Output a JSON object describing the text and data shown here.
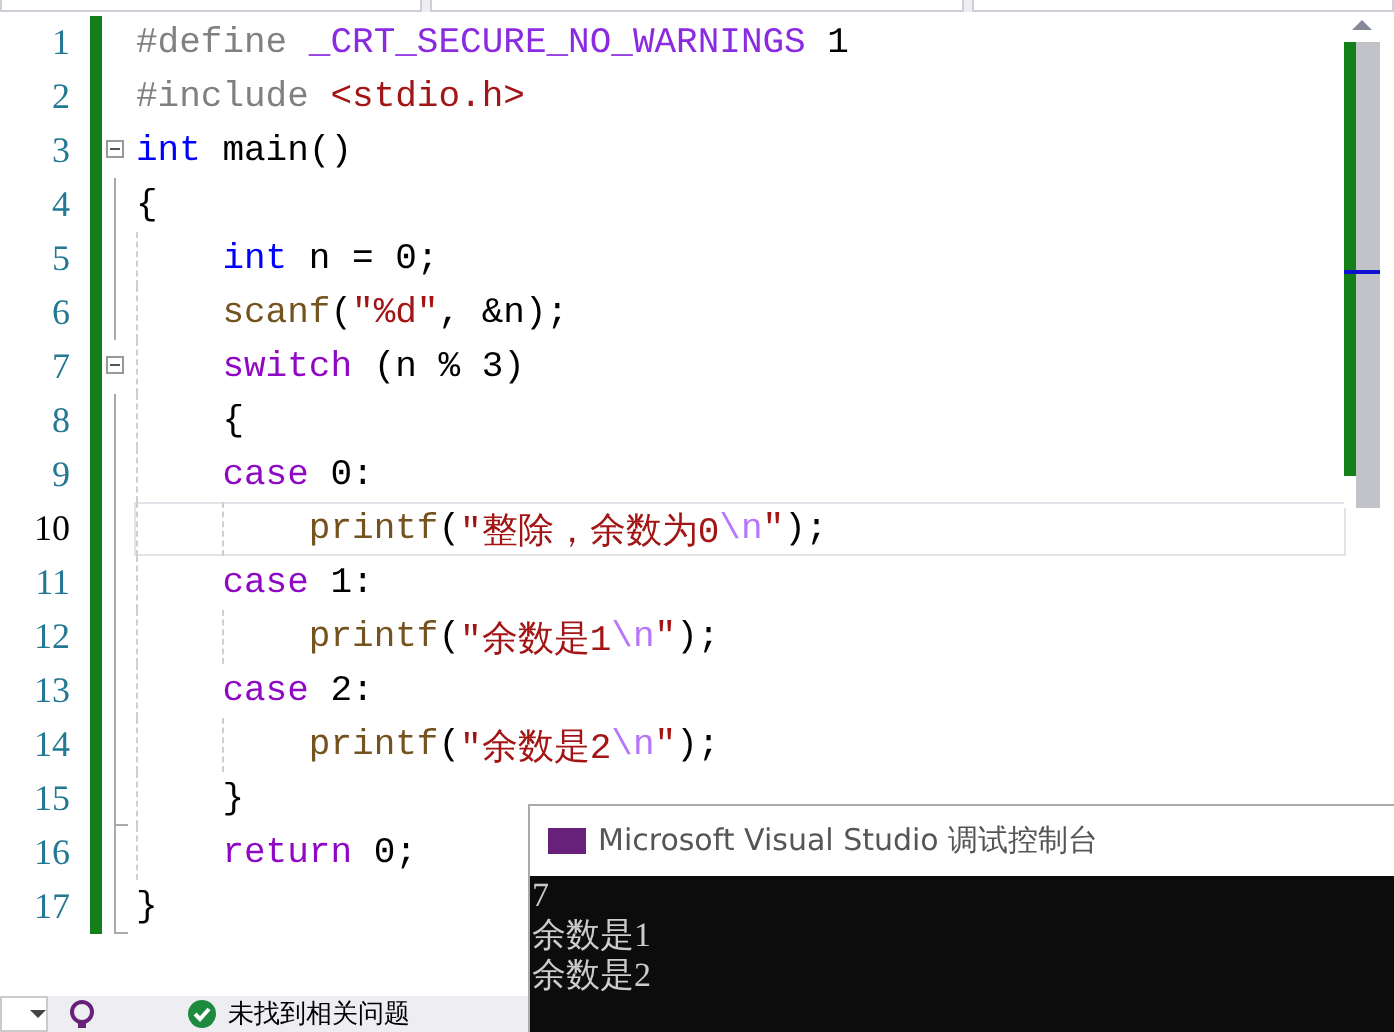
{
  "editor": {
    "lines": [
      {
        "number": "1",
        "changed": true,
        "current": false,
        "tokens": [
          {
            "text": "#define ",
            "kind": "preproc"
          },
          {
            "text": "_CRT_SECURE_NO_WARNINGS",
            "kind": "macro"
          },
          {
            "text": " 1",
            "kind": "plain"
          }
        ]
      },
      {
        "number": "2",
        "changed": true,
        "current": false,
        "tokens": [
          {
            "text": "#include ",
            "kind": "preproc"
          },
          {
            "text": "<stdio.h>",
            "kind": "string"
          }
        ]
      },
      {
        "number": "3",
        "changed": true,
        "current": false,
        "collapsible": true,
        "expanded": true,
        "tokens": [
          {
            "text": "int",
            "kind": "keyword"
          },
          {
            "text": " main()",
            "kind": "plain"
          }
        ]
      },
      {
        "number": "4",
        "changed": true,
        "current": false,
        "tokens": [
          {
            "text": "{",
            "kind": "plain"
          }
        ]
      },
      {
        "number": "5",
        "changed": true,
        "current": false,
        "tokens": [
          {
            "text": "    int",
            "kind": "keyword"
          },
          {
            "text": " n = 0;",
            "kind": "plain"
          }
        ]
      },
      {
        "number": "6",
        "changed": true,
        "current": false,
        "tokens": [
          {
            "text": "    scanf",
            "kind": "function"
          },
          {
            "text": "(",
            "kind": "plain"
          },
          {
            "text": "\"%d\"",
            "kind": "string"
          },
          {
            "text": ", &n);",
            "kind": "plain"
          }
        ]
      },
      {
        "number": "7",
        "changed": true,
        "current": false,
        "collapsible": true,
        "expanded": true,
        "tokens": [
          {
            "text": "    switch",
            "kind": "control"
          },
          {
            "text": " (n % 3)",
            "kind": "plain"
          }
        ]
      },
      {
        "number": "8",
        "changed": true,
        "current": false,
        "tokens": [
          {
            "text": "    {",
            "kind": "plain"
          }
        ]
      },
      {
        "number": "9",
        "changed": true,
        "current": false,
        "tokens": [
          {
            "text": "    case",
            "kind": "control"
          },
          {
            "text": " 0:",
            "kind": "plain"
          }
        ]
      },
      {
        "number": "10",
        "changed": true,
        "current": true,
        "tokens": [
          {
            "text": "        printf",
            "kind": "function"
          },
          {
            "text": "(",
            "kind": "plain"
          },
          {
            "text": "\"整除，余数为0",
            "kind": "string"
          },
          {
            "text": "\\n",
            "kind": "escape"
          },
          {
            "text": "\"",
            "kind": "string"
          },
          {
            "text": ");",
            "kind": "plain"
          }
        ]
      },
      {
        "number": "11",
        "changed": true,
        "current": false,
        "tokens": [
          {
            "text": "    case",
            "kind": "control"
          },
          {
            "text": " 1:",
            "kind": "plain"
          }
        ]
      },
      {
        "number": "12",
        "changed": true,
        "current": false,
        "tokens": [
          {
            "text": "        printf",
            "kind": "function"
          },
          {
            "text": "(",
            "kind": "plain"
          },
          {
            "text": "\"余数是1",
            "kind": "string"
          },
          {
            "text": "\\n",
            "kind": "escape"
          },
          {
            "text": "\"",
            "kind": "string"
          },
          {
            "text": ");",
            "kind": "plain"
          }
        ]
      },
      {
        "number": "13",
        "changed": true,
        "current": false,
        "tokens": [
          {
            "text": "    case",
            "kind": "control"
          },
          {
            "text": " 2:",
            "kind": "plain"
          }
        ]
      },
      {
        "number": "14",
        "changed": true,
        "current": false,
        "tokens": [
          {
            "text": "        printf",
            "kind": "function"
          },
          {
            "text": "(",
            "kind": "plain"
          },
          {
            "text": "\"余数是2",
            "kind": "string"
          },
          {
            "text": "\\n",
            "kind": "escape"
          },
          {
            "text": "\"",
            "kind": "string"
          },
          {
            "text": ");",
            "kind": "plain"
          }
        ]
      },
      {
        "number": "15",
        "changed": true,
        "current": false,
        "block_end": true,
        "tokens": [
          {
            "text": "    }",
            "kind": "plain"
          }
        ]
      },
      {
        "number": "16",
        "changed": true,
        "current": false,
        "tokens": [
          {
            "text": "    return",
            "kind": "control"
          },
          {
            "text": " 0;",
            "kind": "plain"
          }
        ]
      },
      {
        "number": "17",
        "changed": true,
        "current": false,
        "block_end": true,
        "tokens": [
          {
            "text": "}",
            "kind": "plain"
          }
        ]
      }
    ]
  },
  "console": {
    "title": "Microsoft Visual Studio 调试控制台",
    "output": [
      "7",
      "余数是1",
      "余数是2"
    ]
  },
  "status_bar": {
    "issues_text": "未找到相关问题"
  }
}
